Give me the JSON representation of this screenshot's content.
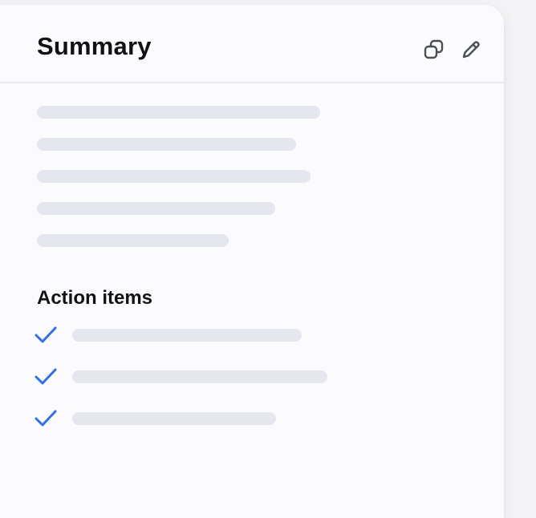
{
  "card": {
    "title": "Summary",
    "icons": {
      "copy": "copy-icon",
      "edit": "pencil-icon"
    }
  },
  "summary": {
    "placeholder_lines": 5
  },
  "action_items": {
    "title": "Action items",
    "count": 3,
    "icon": "check-icon",
    "accent": "#2f6fed"
  },
  "colors": {
    "card_bg": "#fbfbfd",
    "skeleton": "#e4e7ee",
    "title_text": "#111217",
    "icon_stroke": "#4a4e57"
  }
}
